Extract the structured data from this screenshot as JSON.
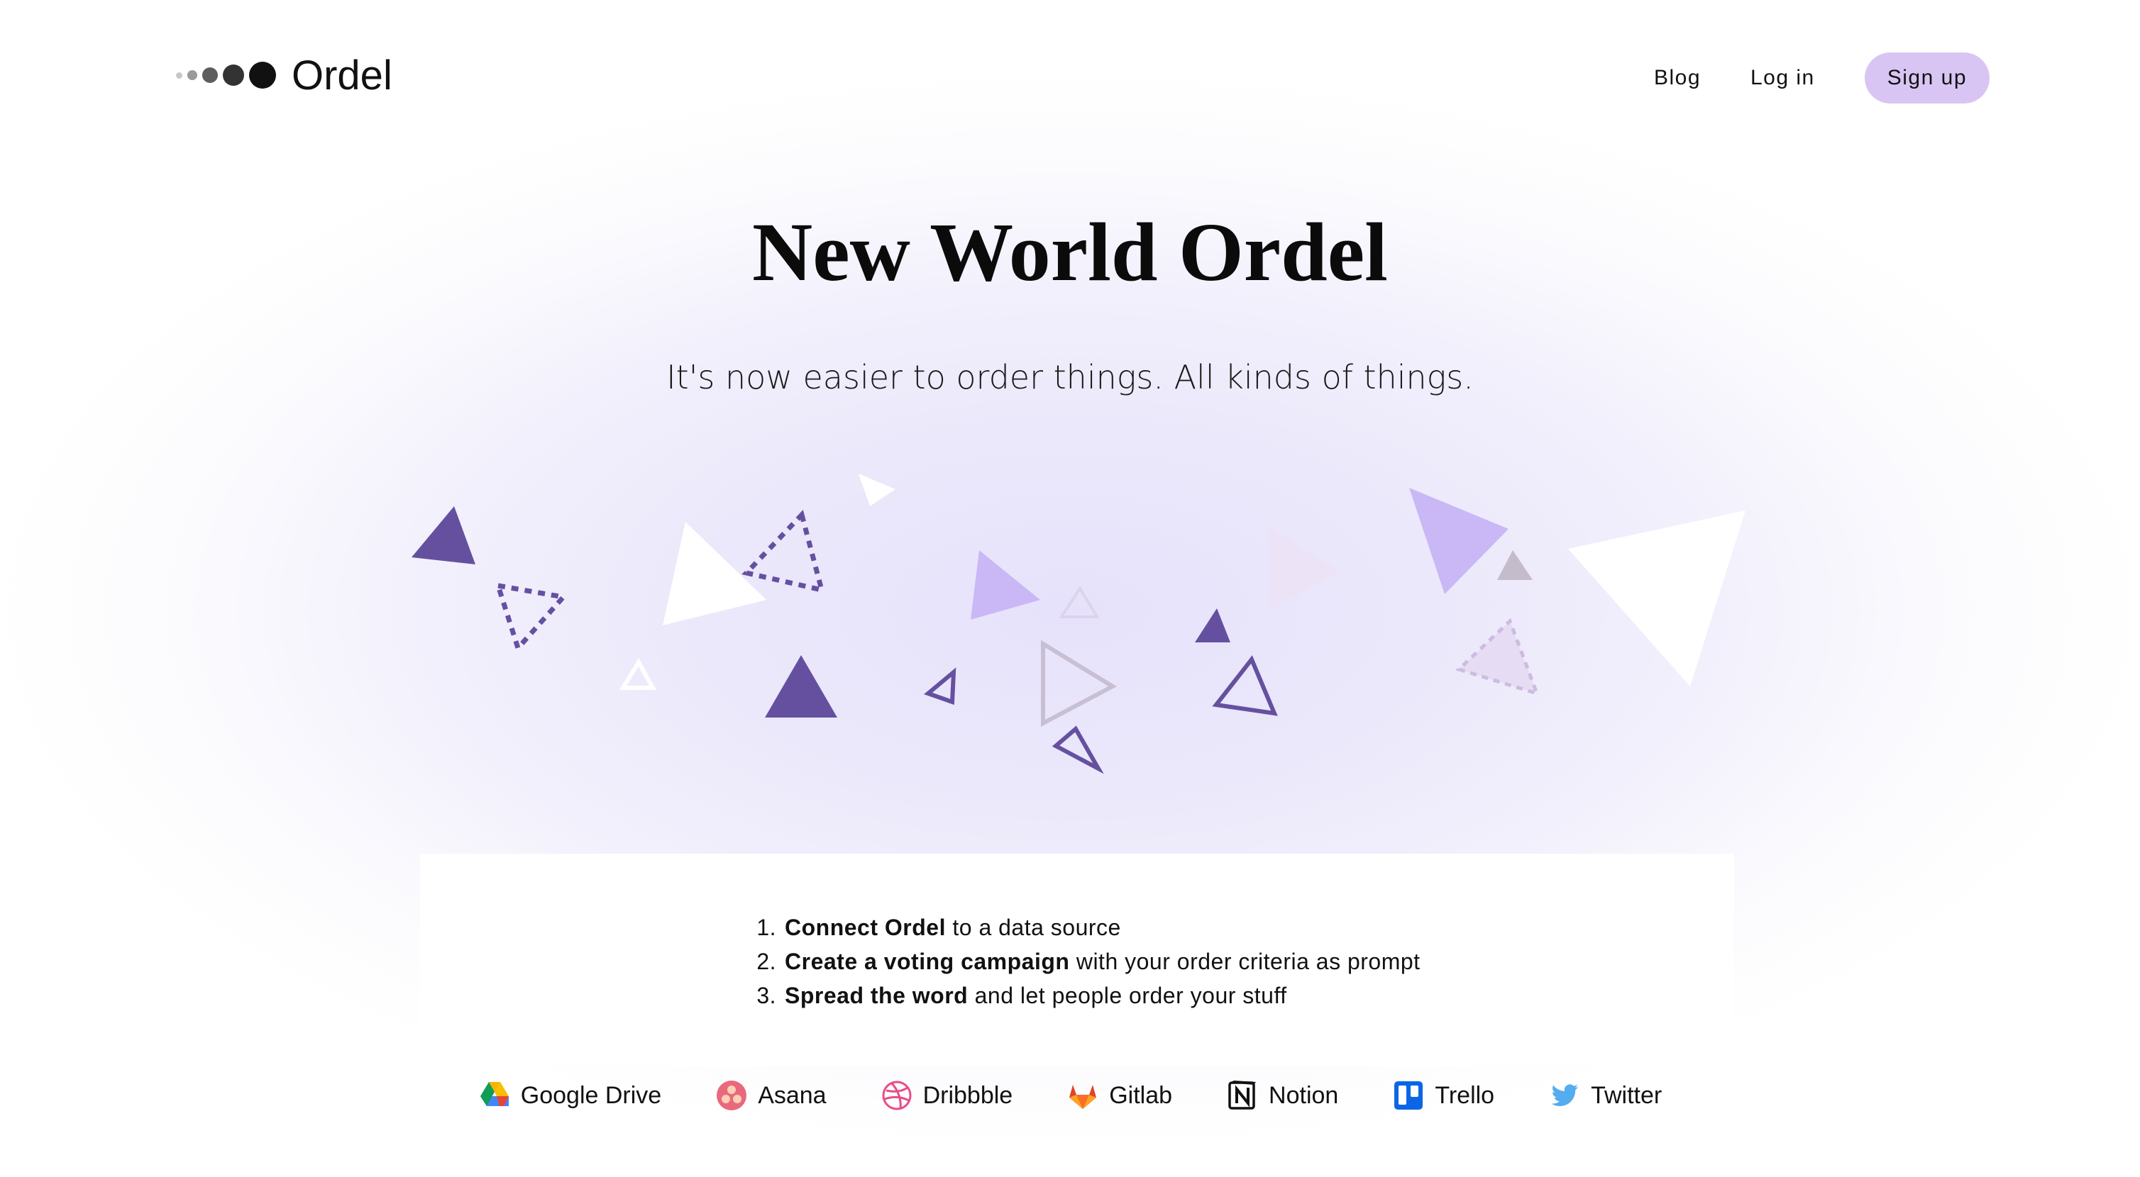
{
  "brand": {
    "name": "Ordel",
    "dot_colors": [
      "#c8c8c8",
      "#9a9a9a",
      "#5e5e5e",
      "#333333",
      "#111111"
    ]
  },
  "nav": {
    "blog_label": "Blog",
    "login_label": "Log in",
    "signup_label": "Sign up",
    "signup_color": "#d9c5f3"
  },
  "hero": {
    "title": "New World Ordel",
    "subtitle": "It's now easier to order things. All kinds of things."
  },
  "steps": [
    {
      "number": "1.",
      "bold": "Connect Ordel",
      "rest": " to a data source"
    },
    {
      "number": "2.",
      "bold": "Create a voting campaign",
      "rest": " with your order criteria as prompt"
    },
    {
      "number": "3.",
      "bold": "Spread the word",
      "rest": " and let people order your stuff"
    }
  ],
  "integrations": [
    {
      "label": "Google Drive",
      "icon": "google-drive-icon"
    },
    {
      "label": "Asana",
      "icon": "asana-icon"
    },
    {
      "label": "Dribbble",
      "icon": "dribbble-icon"
    },
    {
      "label": "Gitlab",
      "icon": "gitlab-icon"
    },
    {
      "label": "Notion",
      "icon": "notion-icon"
    },
    {
      "label": "Trello",
      "icon": "trello-icon"
    },
    {
      "label": "Twitter",
      "icon": "twitter-icon"
    }
  ],
  "colors": {
    "dark_purple": "#6550a0",
    "light_purple": "#c9b8f5",
    "pale_purple": "#e6dcf3",
    "gray_purple": "#c4bccb"
  }
}
